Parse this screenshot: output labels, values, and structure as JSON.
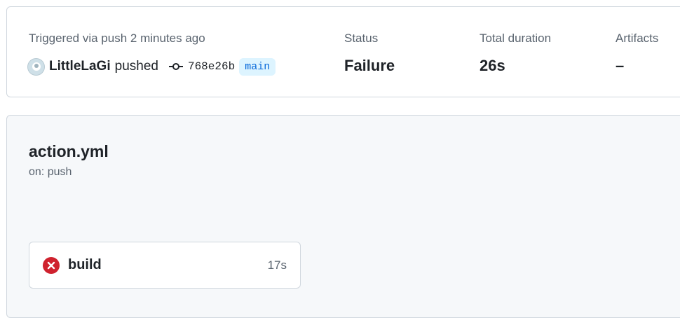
{
  "summary": {
    "trigger_text": "Triggered via push 2 minutes ago",
    "user": "LittleLaGi",
    "action": "pushed",
    "commit_sha": "768e26b",
    "branch": "main",
    "status_label": "Status",
    "status_value": "Failure",
    "duration_label": "Total duration",
    "duration_value": "26s",
    "artifacts_label": "Artifacts",
    "artifacts_value": "–"
  },
  "workflow": {
    "name": "action.yml",
    "trigger": "on: push",
    "jobs": [
      {
        "name": "build",
        "duration": "17s",
        "status": "failure",
        "status_icon": "x-circle-icon"
      }
    ]
  },
  "colors": {
    "failure": "#cf222e",
    "branch_text": "#0969da",
    "branch_bg": "#ddf4ff",
    "muted_text": "#59636e",
    "border": "#d0d7de",
    "graph_bg": "#f6f8fa"
  }
}
